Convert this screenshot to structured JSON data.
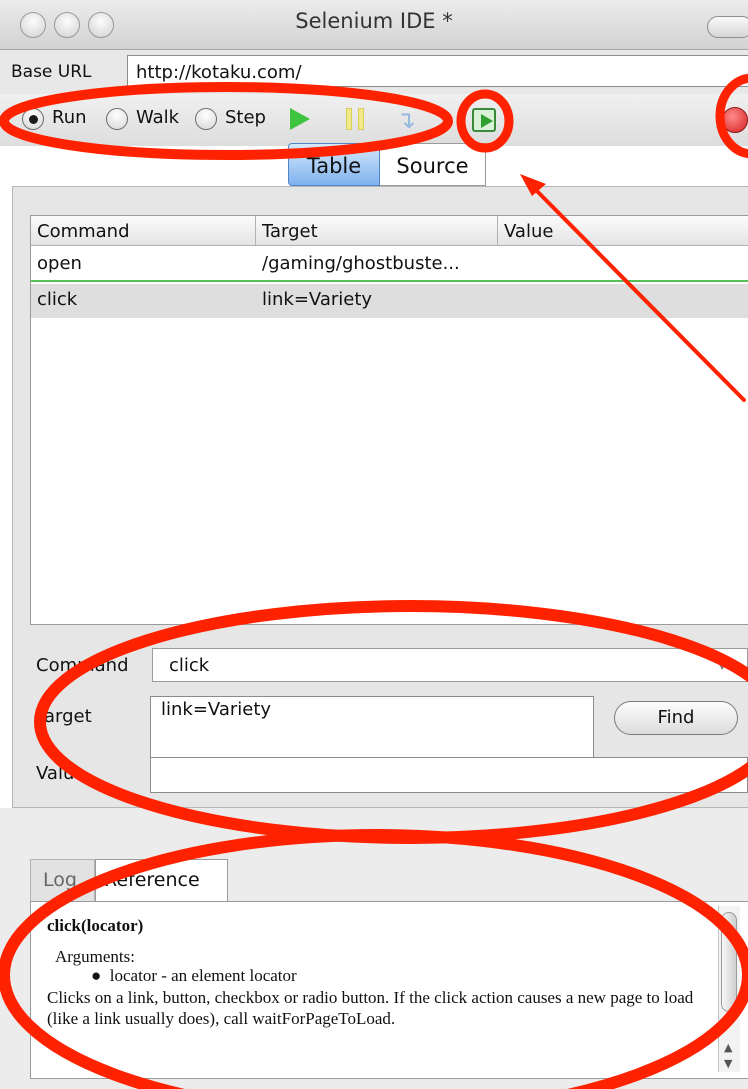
{
  "window": {
    "title": "Selenium IDE *"
  },
  "base_url": {
    "label": "Base URL",
    "value": "http://kotaku.com/"
  },
  "toolbar": {
    "run_label": "Run",
    "walk_label": "Walk",
    "step_label": "Step",
    "selected_mode": "Run",
    "icons": [
      "play-icon",
      "pause-icon",
      "step-icon",
      "play-suite-icon",
      "record-icon"
    ]
  },
  "view_tabs": {
    "table": "Table",
    "source": "Source",
    "active": "Table"
  },
  "commands_table": {
    "headers": [
      "Command",
      "Target",
      "Value"
    ],
    "rows": [
      {
        "command": "open",
        "target": "/gaming/ghostbuste...",
        "value": ""
      },
      {
        "command": "click",
        "target": "link=Variety",
        "value": ""
      }
    ]
  },
  "editor": {
    "command_label": "Command",
    "command_value": "click",
    "target_label": "Target",
    "target_value": "link=Variety",
    "find_label": "Find",
    "value_label": "Value",
    "value_value": ""
  },
  "bottom_tabs": {
    "log": "Log",
    "reference": "Reference",
    "active": "Reference"
  },
  "reference": {
    "signature": "click(locator)",
    "arguments_heading": "Arguments:",
    "argument": "locator - an element locator",
    "description": "Clicks on a link, button, checkbox or radio button. If the click action causes a new page to load (like a link usually does), call waitForPageToLoad."
  },
  "colors": {
    "annotation": "#ff2200",
    "play": "#3fc43f",
    "record": "#d62020",
    "active_tab": "#7fb2ee",
    "row_separator": "#55c055"
  }
}
